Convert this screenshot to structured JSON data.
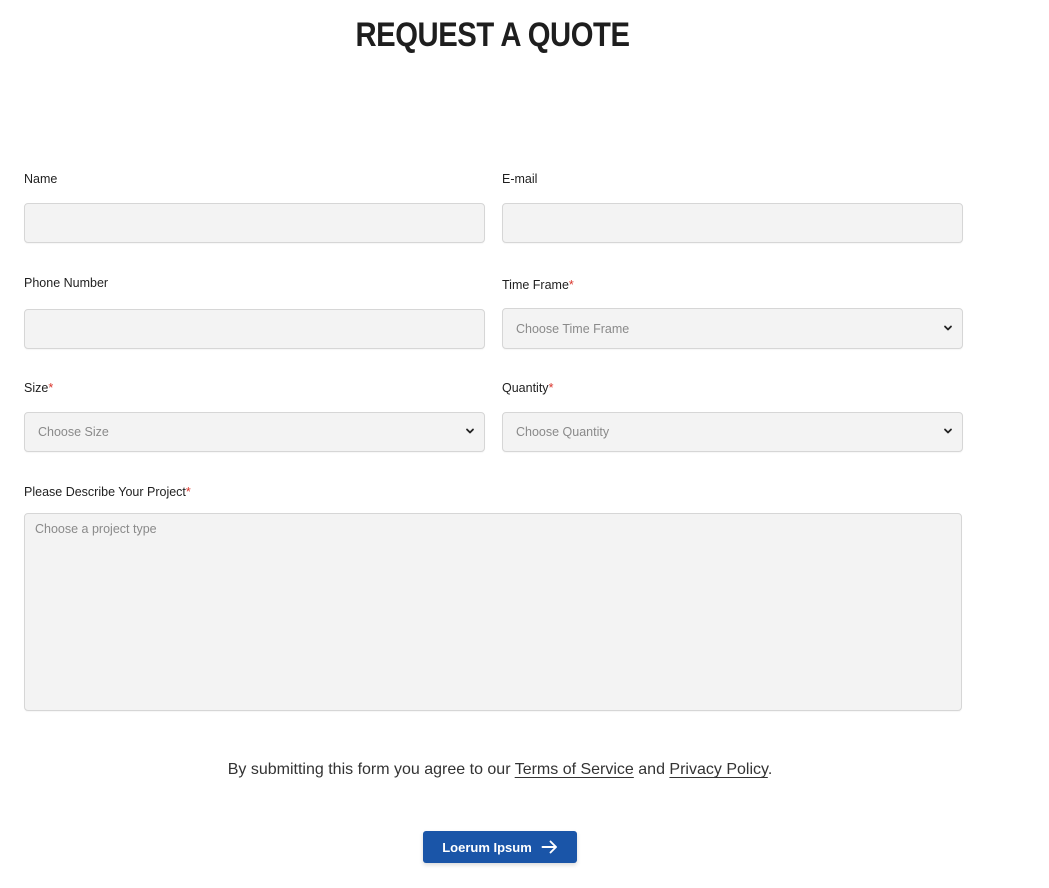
{
  "title": "REQUEST A QUOTE",
  "form": {
    "name": {
      "label": "Name",
      "value": ""
    },
    "email": {
      "label": "E-mail",
      "value": ""
    },
    "phone": {
      "label": "Phone Number",
      "value": ""
    },
    "time_frame": {
      "label": "Time Frame",
      "required_mark": "*",
      "selected": "Choose Time Frame"
    },
    "size": {
      "label": "Size",
      "required_mark": "*",
      "selected": "Choose Size"
    },
    "quantity": {
      "label": "Quantity",
      "required_mark": "*",
      "selected": "Choose Quantity"
    },
    "project": {
      "label": "Please Describe Your Project",
      "required_mark": "*",
      "placeholder": "Choose a project type"
    }
  },
  "consent": {
    "prefix": "By submitting this form you agree to our ",
    "terms": "Terms of Service",
    "middle": " and ",
    "privacy": "Privacy Policy",
    "suffix": "."
  },
  "submit": {
    "label": "Loerum Ipsum",
    "icon": "arrow-right-icon"
  },
  "colors": {
    "accent": "#1a55a8",
    "required": "#d9342b",
    "field_bg": "#f3f3f3"
  }
}
